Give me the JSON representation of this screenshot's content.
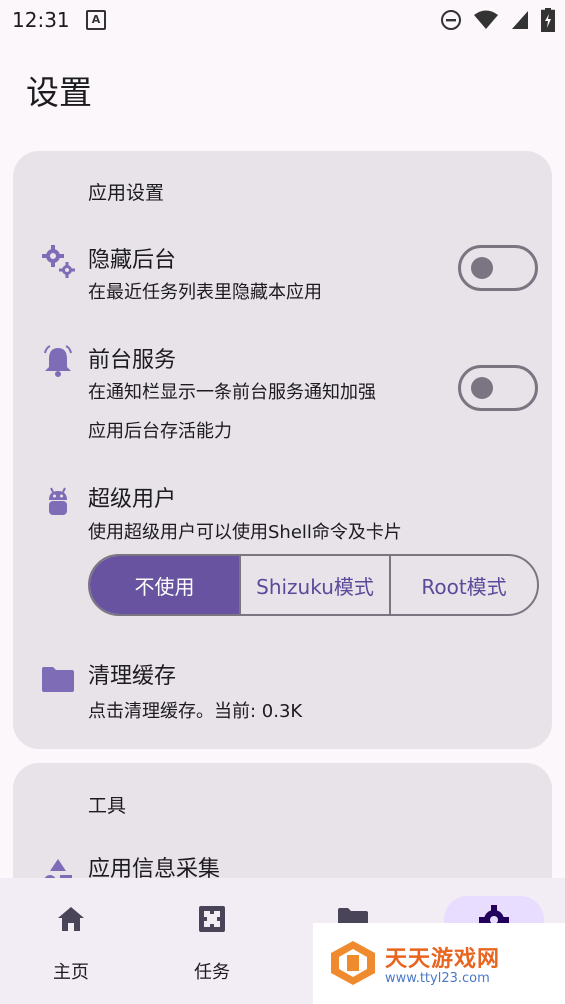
{
  "status_bar": {
    "time": "12:31",
    "notification_letter": "A",
    "icons": [
      "do-not-disturb-icon",
      "wifi-icon",
      "signal-icon",
      "battery-charging-icon"
    ]
  },
  "page": {
    "title": "设置"
  },
  "app_settings": {
    "header": "应用设置",
    "hide_background": {
      "title": "隐藏后台",
      "description": "在最近任务列表里隐藏本应用",
      "enabled": false,
      "icon": "gears-icon"
    },
    "foreground_service": {
      "title": "前台服务",
      "description_line1": "在通知栏显示一条前台服务通知加强",
      "description_line2": "应用后台存活能力",
      "enabled": false,
      "icon": "bell-icon"
    },
    "superuser": {
      "title": "超级用户",
      "description": "使用超级用户可以使用Shell命令及卡片",
      "icon": "android-icon",
      "options": [
        "不使用",
        "Shizuku模式",
        "Root模式"
      ],
      "selected": "不使用"
    },
    "clear_cache": {
      "title": "清理缓存",
      "description": "点击清理缓存。当前: 0.3K",
      "icon": "folder-icon"
    }
  },
  "tools": {
    "header": "工具",
    "app_info": {
      "title": "应用信息采集",
      "icon": "shapes-icon"
    }
  },
  "bottom_nav": {
    "items": [
      {
        "label": "主页",
        "icon": "home-icon"
      },
      {
        "label": "任务",
        "icon": "tasks-icon"
      },
      {
        "label": "",
        "icon": "folder-icon"
      },
      {
        "label": "",
        "icon": "settings-icon",
        "active": true
      }
    ]
  },
  "watermark": {
    "brand": "天天游戏网",
    "url": "www.ttyl23.com"
  },
  "colors": {
    "accent": "#67539f",
    "card": "#e8e2e9",
    "background": "#fcf7fb",
    "icon": "#7e6cb7"
  }
}
